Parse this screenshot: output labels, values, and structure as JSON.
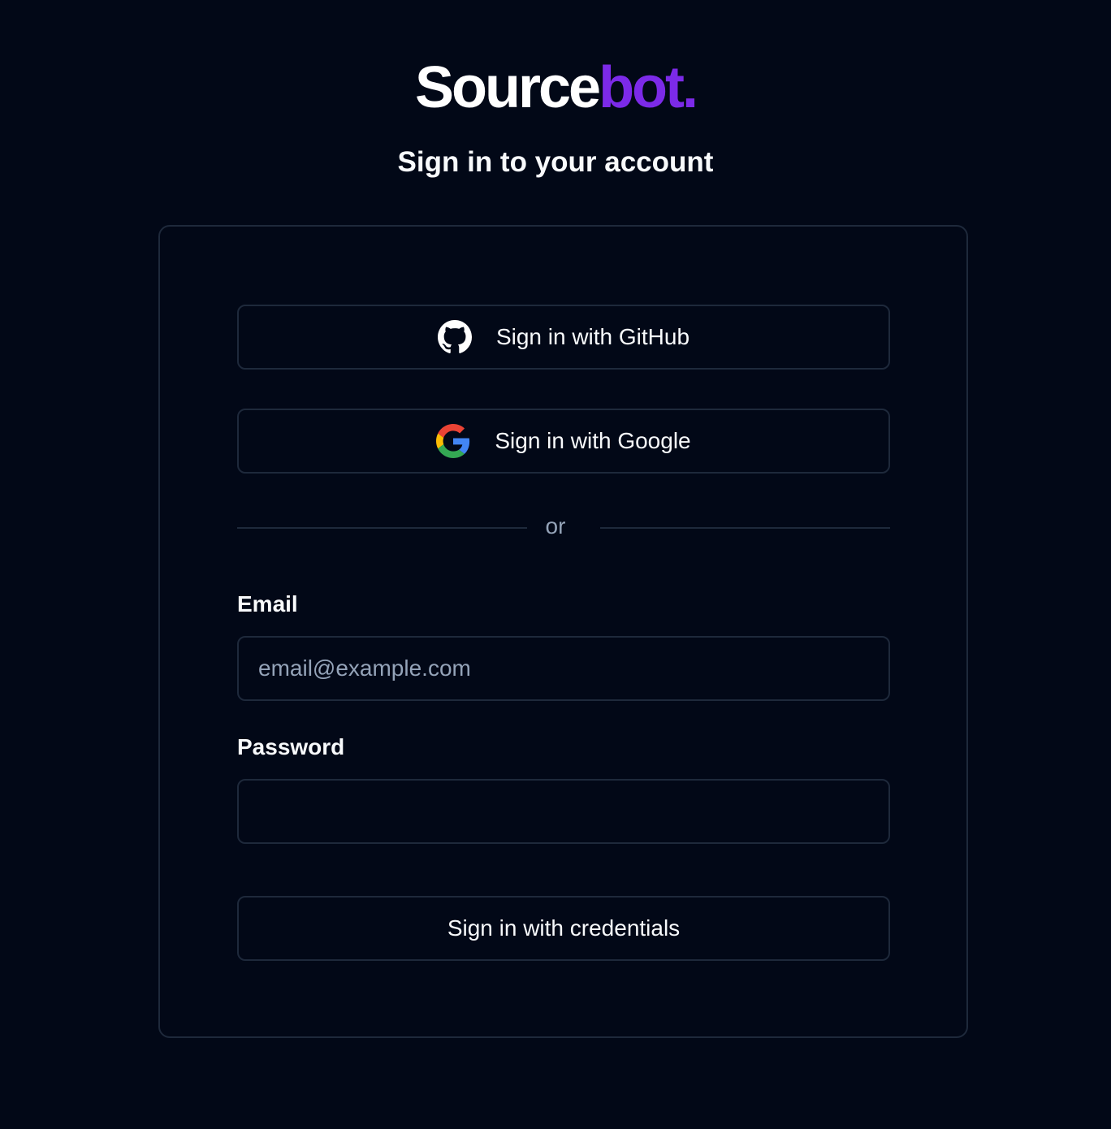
{
  "brand": {
    "part1": "Source",
    "part2": "bot.",
    "accent": "#7c2ae8"
  },
  "title": "Sign in to your account",
  "providers": [
    {
      "label": "Sign in with GitHub",
      "icon": "github-icon"
    },
    {
      "label": "Sign in with Google",
      "icon": "google-icon"
    }
  ],
  "divider_text": "or",
  "form": {
    "email_label": "Email",
    "email_placeholder": "email@example.com",
    "email_value": "",
    "password_label": "Password",
    "password_value": "",
    "submit_label": "Sign in with credentials"
  }
}
